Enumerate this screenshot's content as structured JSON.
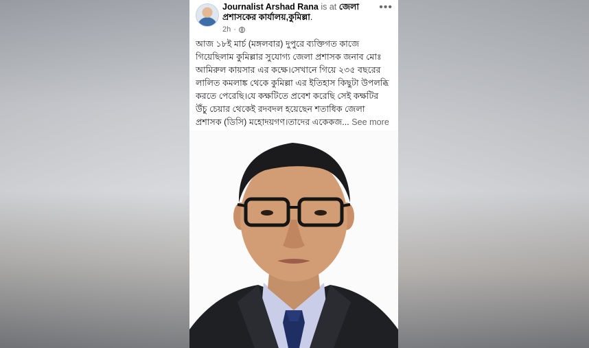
{
  "post": {
    "author": "Journalist Arshad Rana",
    "connector": "is at",
    "location": "জেলা প্রশাসকের কার্যালয়,কুমিল্লা",
    "location_suffix": ".",
    "time": "2h",
    "privacy_icon": "globe-icon",
    "menu_icon": "more-options-icon",
    "text": "আজ ১৮ই মার্চ (মঙ্গলবার) দুপুরে ব্যক্তিগত কাজে\nগিয়েছিলাম কুমিল্লার সুযোগ্য জেলা প্রশাসক জনাব মোঃ\nআমিরুল কায়সার এর কক্ষে।সেখানে গিয়ে ২৩৫ বছরের\nলালিত কমলাঙ্ক থেকে কুমিল্লা এর ইতিহাস কিছুটা উপলব্ধি\nকরতে পেরেছি।যে কক্ষটিতে প্রবেশ করেছি সেই কক্ষটির\nউঁচু চেয়ার থেকেই রদবদল হয়েছেন শতাধিক জেলা\nপ্রশাসক (ডিসি) মহোদয়গণ।তাদের একেকজ...",
    "see_more": " See more"
  },
  "colors": {
    "text": "#1c1e21",
    "muted": "#65676b",
    "card_bg": "#ffffff"
  }
}
